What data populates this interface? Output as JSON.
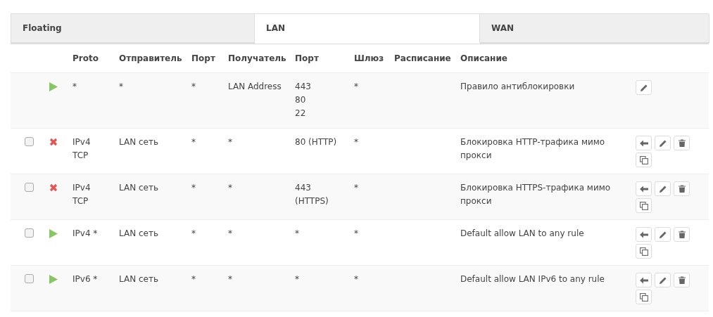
{
  "tabs": [
    {
      "label": "Floating",
      "selected": false
    },
    {
      "label": "LAN",
      "selected": true
    },
    {
      "label": "WAN",
      "selected": false
    }
  ],
  "table": {
    "columns": [
      "Proto",
      "Отправитель",
      "Порт",
      "Получатель",
      "Порт",
      "Шлюз",
      "Расписание",
      "Описание"
    ],
    "rows": [
      {
        "action_icon": {
          "kind": "pass"
        },
        "proto": [
          "*"
        ],
        "source": "*",
        "source_port": "*",
        "destination": "LAN Address",
        "destination_port": [
          "443",
          "80",
          "22"
        ],
        "gateway": "*",
        "description": "Правило антиблокировки",
        "buttons": [
          {
            "kind": "edit"
          }
        ]
      },
      {
        "checkbox": {
          "checked": false
        },
        "action_icon": {
          "kind": "block"
        },
        "proto": [
          "IPv4",
          "TCP"
        ],
        "source": "LAN сеть",
        "source_port": "*",
        "destination": "*",
        "destination_port": [
          "80 (HTTP)"
        ],
        "gateway": "*",
        "description": "Блокировка HTTP-трафика мимо прокси",
        "buttons": [
          {
            "kind": "move"
          },
          {
            "kind": "edit"
          },
          {
            "kind": "delete"
          },
          {
            "kind": "copy"
          }
        ]
      },
      {
        "checkbox": {
          "checked": false
        },
        "action_icon": {
          "kind": "block"
        },
        "proto": [
          "IPv4",
          "TCP"
        ],
        "source": "LAN сеть",
        "source_port": "*",
        "destination": "*",
        "destination_port": [
          "443",
          "(HTTPS)"
        ],
        "gateway": "*",
        "description": "Блокировка HTTPS-трафика мимо прокси",
        "buttons": [
          {
            "kind": "move"
          },
          {
            "kind": "edit"
          },
          {
            "kind": "delete"
          },
          {
            "kind": "copy"
          }
        ]
      },
      {
        "checkbox": {
          "checked": false
        },
        "action_icon": {
          "kind": "pass"
        },
        "proto": [
          "IPv4 *"
        ],
        "source": "LAN сеть",
        "source_port": "*",
        "destination": "*",
        "destination_port": [
          "*"
        ],
        "gateway": "*",
        "description": "Default allow LAN to any rule",
        "buttons": [
          {
            "kind": "move"
          },
          {
            "kind": "edit"
          },
          {
            "kind": "delete"
          },
          {
            "kind": "copy"
          }
        ]
      },
      {
        "checkbox": {
          "checked": false
        },
        "action_icon": {
          "kind": "pass"
        },
        "proto": [
          "IPv6 *"
        ],
        "source": "LAN сеть",
        "source_port": "*",
        "destination": "*",
        "destination_port": [
          "*"
        ],
        "gateway": "*",
        "description": "Default allow LAN IPv6 to any rule",
        "buttons": [
          {
            "kind": "move"
          },
          {
            "kind": "edit"
          },
          {
            "kind": "delete"
          },
          {
            "kind": "copy"
          }
        ]
      }
    ]
  }
}
